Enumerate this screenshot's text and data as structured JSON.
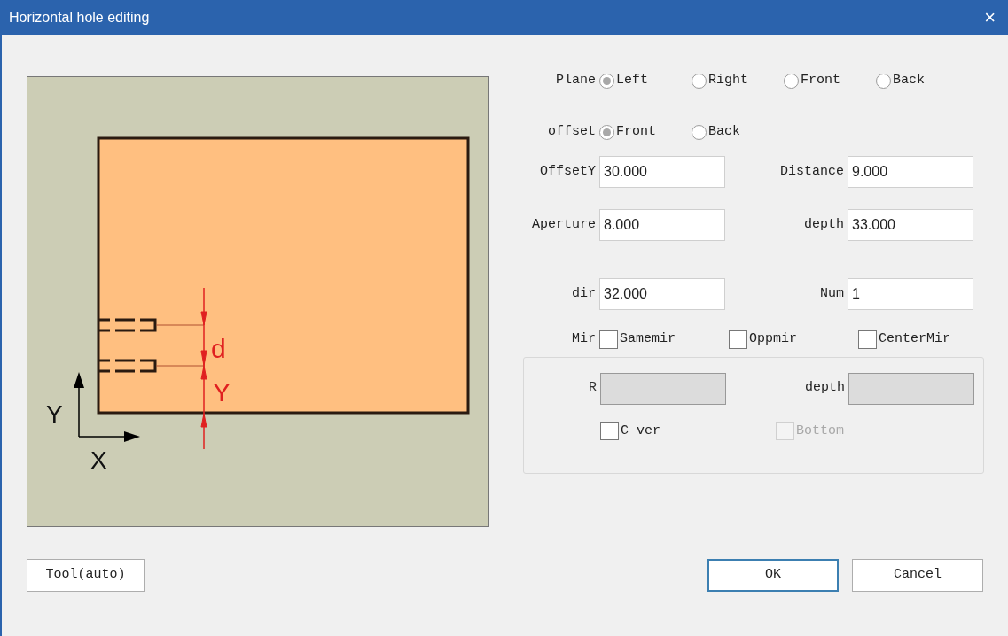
{
  "window": {
    "title": "Horizontal hole editing",
    "close": "×"
  },
  "diagram": {
    "axis_labels": [
      "Y",
      "X"
    ],
    "dimension_labels": [
      "d",
      "Y"
    ]
  },
  "plane": {
    "label": "Plane",
    "options": [
      {
        "label": "Left",
        "selected": true
      },
      {
        "label": "Right",
        "selected": false
      },
      {
        "label": "Front",
        "selected": false
      },
      {
        "label": "Back",
        "selected": false
      }
    ]
  },
  "offset": {
    "label": "offset",
    "options": [
      {
        "label": "Front",
        "selected": true
      },
      {
        "label": "Back",
        "selected": false
      }
    ]
  },
  "fields": [
    {
      "label": "OffsetY",
      "value": "30.000"
    },
    {
      "label": "Distance",
      "value": "9.000"
    },
    {
      "label": "Aperture",
      "value": "8.000"
    },
    {
      "label": "depth",
      "value": "33.000"
    },
    {
      "label": "dir",
      "value": "32.000"
    },
    {
      "label": "Num",
      "value": "1"
    }
  ],
  "mirror": {
    "label": "Mir",
    "options": [
      {
        "label": "Samemir",
        "checked": false
      },
      {
        "label": "Oppmir",
        "checked": false
      },
      {
        "label": "CenterMir",
        "checked": false
      }
    ]
  },
  "group": {
    "fields": [
      {
        "label": "R",
        "disabled": true
      },
      {
        "label": "depth",
        "disabled": true
      }
    ],
    "checks": [
      {
        "label": "C ver",
        "checked": false,
        "disabled": false
      },
      {
        "label": "Bottom",
        "checked": false,
        "disabled": true
      }
    ]
  },
  "buttons": [
    {
      "label": "Tool(auto)",
      "default": false
    },
    {
      "label": "OK",
      "default": true
    },
    {
      "label": "Cancel",
      "default": false
    }
  ]
}
